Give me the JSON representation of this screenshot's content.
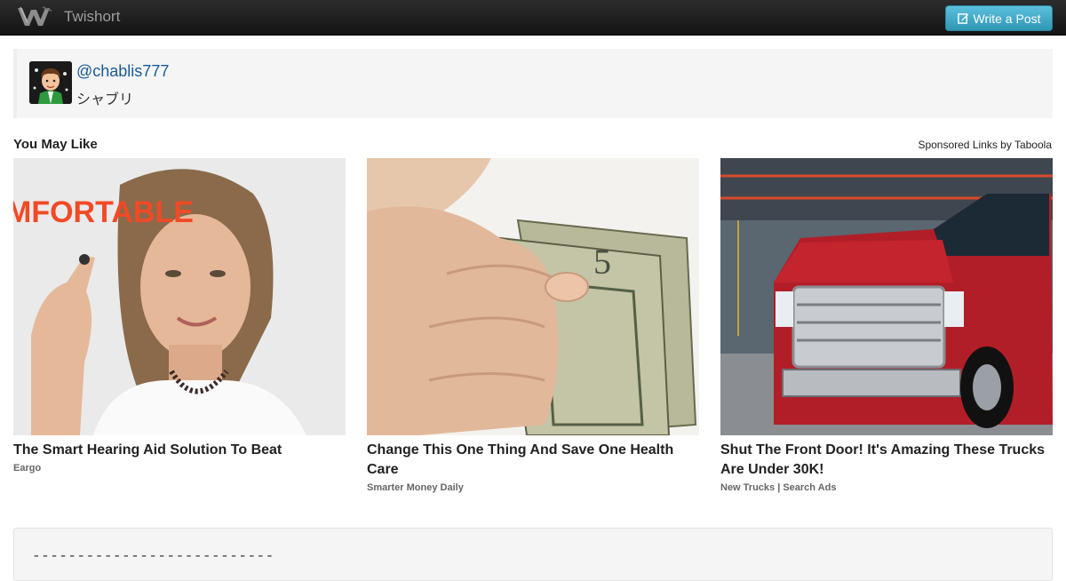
{
  "navbar": {
    "brand": "Twishort",
    "write_button": "Write a Post"
  },
  "post": {
    "username": "@chablis777",
    "display_name": "シャブリ"
  },
  "recommendations": {
    "title": "You May Like",
    "sponsored": "Sponsored Links by Taboola",
    "cards": [
      {
        "title": "The Smart Hearing Aid Solution To Beat",
        "source": "Eargo",
        "image_text": "MFORTABLE"
      },
      {
        "title": "Change This One Thing And Save One Health Care",
        "source": "Smarter Money Daily"
      },
      {
        "title": "Shut The Front Door! It's Amazing These Trucks Are Under 30K!",
        "source": "New Trucks | Search Ads"
      }
    ]
  },
  "body": {
    "text": "---------------------------"
  },
  "colors": {
    "navbar": "#1b1b1b",
    "button": "#49afcd",
    "link": "#1a5a96",
    "panel": "#f5f5f5"
  }
}
